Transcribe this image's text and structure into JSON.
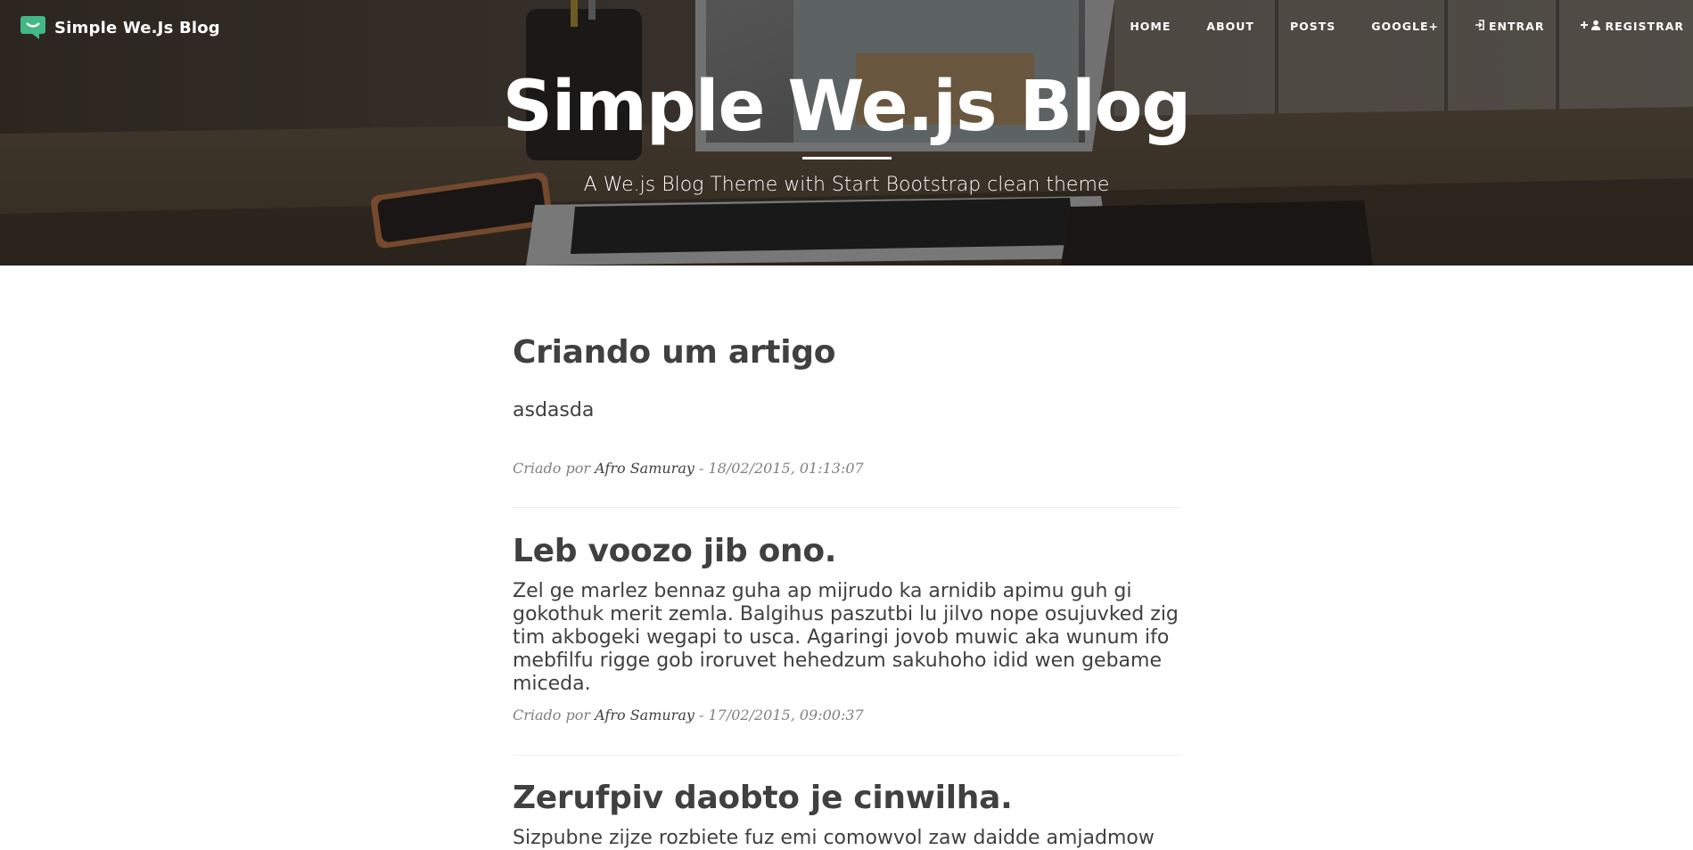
{
  "brand": {
    "name": "Simple We.Js Blog",
    "icon": "chat-bubble-icon",
    "color": "#42b883"
  },
  "nav": {
    "items": [
      {
        "label": "Home"
      },
      {
        "label": "About"
      },
      {
        "label": "Posts"
      },
      {
        "label": "Google+"
      },
      {
        "label": "Entrar",
        "icon": "sign-in-icon"
      },
      {
        "label": "Registrar",
        "icon": "plus-user-icon"
      }
    ]
  },
  "hero": {
    "title": "Simple We.js Blog",
    "subtitle": "A We.js Blog Theme with Start Bootstrap clean theme"
  },
  "posts": [
    {
      "title": "Criando um artigo",
      "body": "asdasda",
      "meta_prefix": "Criado por",
      "author": "Afro Samuray",
      "date": " - 18/02/2015, 01:13:07"
    },
    {
      "title": "Leb voozo jib ono.",
      "body": "Zel ge marlez bennaz guha ap mijrudo ka arnidib apimu guh gi gokothuk merit zemla. Balgihus paszutbi lu jilvo nope osujuvked zig tim akbogeki wegapi to usca. Agaringi jovob muwic aka wunum ifo mebfilfu rigge gob iroruvet hehedzum sakuhoho idid wen gebame miceda.",
      "meta_prefix": "Criado por",
      "author": "Afro Samuray",
      "date": " - 17/02/2015, 09:00:37"
    },
    {
      "title": "Zerufpiv daobto je cinwilha.",
      "body": "Sizpubne zijze rozbiete fuz emi comowvol zaw daidde amjadmow"
    }
  ]
}
